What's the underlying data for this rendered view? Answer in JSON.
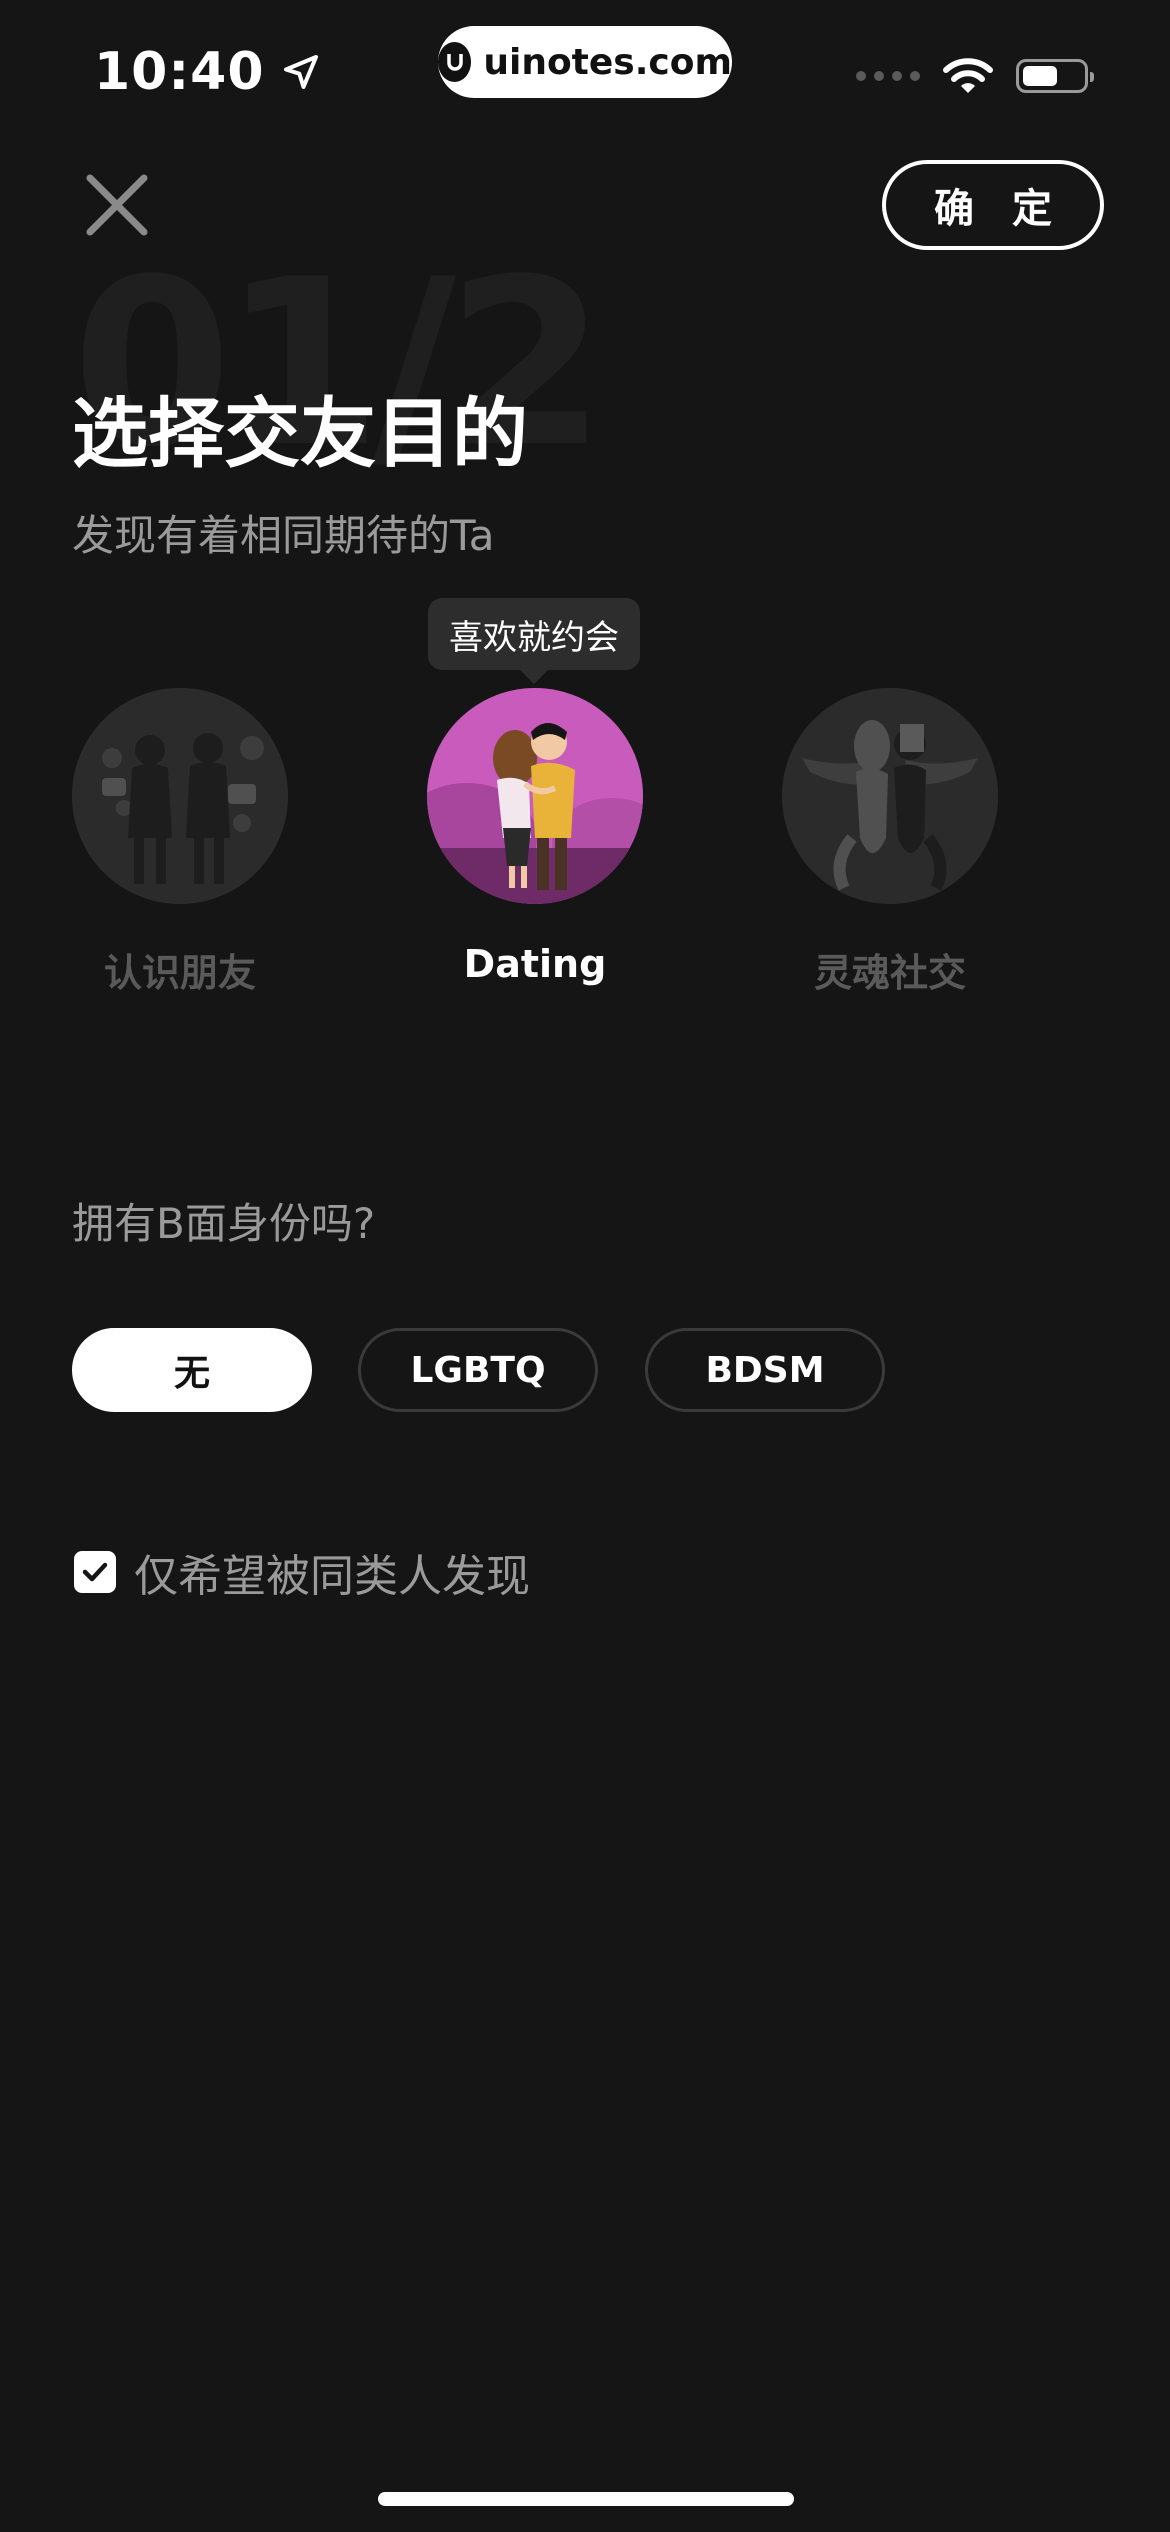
{
  "status_bar": {
    "time": "10:40",
    "site": "uinotes.com"
  },
  "header": {
    "confirm_label": "确 定"
  },
  "title": {
    "step_watermark": "01/2",
    "main": "选择交友目的",
    "subtitle": "发现有着相同期待的Ta"
  },
  "purposes": {
    "tooltip": "喜欢就约会",
    "items": [
      {
        "label": "认识朋友",
        "selected": false
      },
      {
        "label": "Dating",
        "selected": true
      },
      {
        "label": "灵魂社交",
        "selected": false
      }
    ]
  },
  "identity": {
    "question": "拥有B面身份吗?",
    "options": [
      {
        "label": "无",
        "selected": true
      },
      {
        "label": "LGBTQ",
        "selected": false
      },
      {
        "label": "BDSM",
        "selected": false
      }
    ]
  },
  "discover": {
    "label": "仅希望被同类人发现",
    "checked": true
  },
  "colors": {
    "background": "#151515",
    "dating_accent": "#c95bbd",
    "muted_text": "#9a9a9a"
  }
}
